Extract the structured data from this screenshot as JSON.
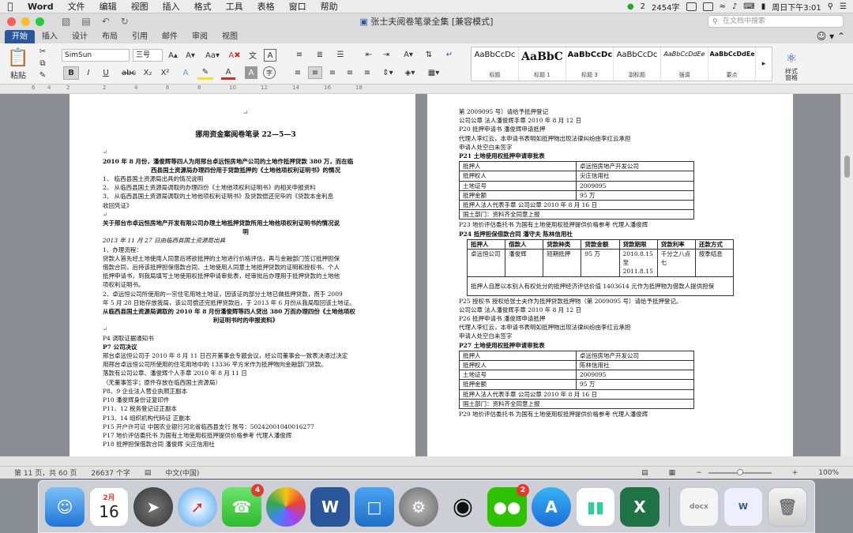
{
  "menubar": {
    "app": "Word",
    "items": [
      "文件",
      "编辑",
      "视图",
      "插入",
      "格式",
      "工具",
      "表格",
      "窗口",
      "帮助"
    ],
    "notification_count": "2",
    "word_count": "2454字",
    "datetime": "周日下午3:01"
  },
  "window": {
    "title": "张士夫阅卷笔录全集 [兼容模式]",
    "search_placeholder": "在文档中搜索"
  },
  "ribbon": {
    "tabs": [
      "开始",
      "插入",
      "设计",
      "布局",
      "引用",
      "邮件",
      "审阅",
      "视图"
    ],
    "paste_label": "粘贴",
    "font_name": "SimSun",
    "font_size": "三号",
    "bold": "B",
    "italic": "I",
    "underline": "U",
    "strike": "abc",
    "subscript": "X₂",
    "superscript": "X²",
    "styles": [
      {
        "preview": "AaBbCcDc",
        "name": "标题"
      },
      {
        "preview": "AaBbC",
        "name": "标题 1"
      },
      {
        "preview": "AaBbCcDc",
        "name": "标题 3"
      },
      {
        "preview": "AaBbCcDc",
        "name": "副标题"
      },
      {
        "preview": "AaBbCcDdEe",
        "name": "强调"
      },
      {
        "preview": "AaBbCcDdEe",
        "name": "要点"
      }
    ],
    "styles_pane": "样式\n窗格"
  },
  "ruler": {
    "marks": [
      "6",
      "4",
      "2",
      "2",
      "4",
      "6",
      "8",
      "10",
      "12",
      "14",
      "16",
      "18"
    ]
  },
  "page1": {
    "heading": "挪用资金案阅卷笔录 22—5—3",
    "l1": "2010 年 8 月份，潘俊辉等四人为用邢台卓远恒房地产公司的土地作抵押贷款 380 万，而在临",
    "l2": "西县国土资源局办理四份用于贷款抵押的《土地他项权利证明书》的情况",
    "items": [
      "1、    临西县国土资源局出具的情况说明",
      "2、    从临西县国土资源局调取的办理四份《土地他项权利证明书》的相关申报资料",
      "3、    从临西县国土资源局调取的土地他项权利证明书》及贷款偿还完毕的《贷款本金利息",
      "        收回凭证》"
    ],
    "b1": "关于邢台市卓远恒房地产开发有限公司办理土地抵押贷款所用土地他项权利证明书的情况说",
    "b2": "明",
    "dateline": "2013 年 11 月 27 日由临西县国土资源局出具",
    "proc": "1、办理流程：",
    "proc_lines": [
      "贷款人首先经土地使用人同意后将欲抵押的土地进行价格评估，再与金融部门签订抵押担保",
      "借款合同，后持该抵押担保借款合同、土地使用人同意土地抵押贷款的证明和授权书、个人",
      "抵押申请书，到我局填写土地使用权抵押申请审批表，经审批后办理用于抵押贷款的土地他",
      "项权利证明书。"
    ],
    "p2_lines": [
      "2、卓远恒公司所使用的一宗住宅用地土地证，因该证的部分土地已做抵押贷款，而于 2009",
      "年 5 月 28 日始存放我局，该公司偿还完抵押贷款后，于 2013 年 6 月份从我局取回该土地证。"
    ],
    "b3": "从临西县国土资源局调取的 2010 年 8 月份潘俊辉等四人贷出 380 万而办理四份《土地他项权",
    "b4": "利证明书时的申报资料》",
    "rec": [
      "P4  调取证据通知书",
      "P7  公司决议",
      "邢台卓远恒公司于 2010 年 8 月 11 日召开董事会专题会议，经公司董事会一致表决通过决定",
      "用邢台卓远恒公司所使用的住宅用地中的 13336 平方米作为抵押物向金融部门贷款。",
      "落款有公司公章、潘俊辉个人手章    2010 年 8 月 11 日",
      "（无董事签字；原件存放在临西国土资源局）",
      "P8、9  企业法人营业执照正副本",
      "P10  潘俊辉身份证复印件",
      "P11、12   税务登记证正副本",
      "P13、14   组织机构代码证  正副本",
      "P15  开户许可证  中国农业银行河北省临西县支行  账号：50242001040016277",
      "P17   地价评估委托书  为国有土地使用权抵押提供价格参考  代理人潘俊辉",
      "P18   抵押担保借款合同  潘俊辉    尖庄信用社"
    ]
  },
  "page2": {
    "top": [
      "第 2009095 号）请给予抵押登记",
      "   公司公章  法人潘俊辉手章   2010 年 8 月 12 日",
      "P20  抵押申请书   潘俊辉申请抵押",
      "代理人李红云，本申请书表明如抵押物出现法律纠纷由李红云承担",
      "申请人处空白未签字",
      "P21    土地使用权抵押申请审批表"
    ],
    "table_a": [
      [
        "抵押人",
        "卓远恒房地产开发公司"
      ],
      [
        "抵押权人",
        "尖庄信用社"
      ],
      [
        "土地证号",
        "2009095"
      ],
      [
        "抵押金额",
        "95 万"
      ]
    ],
    "table_a_foot": [
      "抵押人法人代表手章  公司公章   2010 年 8 月 16 日",
      "国土部门：资料齐全同意上报"
    ],
    "mid": [
      "P23    地价评估委托书    为国有土地使用权抵押提供价格参考  代理人潘俊辉",
      "P24  抵押担保借款合同  潘守夫     陈林信用社"
    ],
    "loan_headers": [
      "抵押人",
      "借款人",
      "贷款种类",
      "贷款金额",
      "贷款期限",
      "贷款利率",
      "还款方式"
    ],
    "loan_row": [
      "卓远恒公司",
      "潘俊辉",
      "短期抵押",
      "95 万",
      "2010.8.15 至 2011.8.15",
      "千分之八点七",
      "按季结息"
    ],
    "loan_note": "抵押人自愿以本别人有权处分的抵押经济评估价值 1403614 元作为抵押物为借款人提供担保",
    "after": [
      "P25    授权书  授权给张士夫作为抵押贷款抵押物（第 2009095 号）请给予抵押登记。",
      "公司公章  法人潘俊辉手章   2010 年 8 月 12 日",
      "P26    抵押申请书    潘俊辉申请抵押",
      "代理人李红云，本申请书表明如抵押物出现法律纠纷由李红云承担",
      "申请人处空白未签字",
      "P27    土地使用权抵押申请审批表"
    ],
    "table_b": [
      [
        "抵押人",
        "卓远恒房地产开发公司"
      ],
      [
        "抵押权人",
        "陈林信用社"
      ],
      [
        "土地证号",
        "2009095"
      ],
      [
        "抵押金额",
        "95 万"
      ]
    ],
    "table_b_foot": [
      "抵押人法人代表手章  公司公章   2010 年 8 月 16 日",
      "国土部门：资料齐全同意上报"
    ],
    "bottom": "P29    地价评估委托书    为国有土地使用权抵押提供价格参考  代理人潘俊辉"
  },
  "status": {
    "page": "第 11 页，共 60 页",
    "words": "26637 个字",
    "language": "中文(中国)",
    "zoom": "100%"
  },
  "dock": {
    "calendar_month": "2月",
    "calendar_day": "16",
    "facetime_badge": "4",
    "wechat_badge": "2"
  }
}
